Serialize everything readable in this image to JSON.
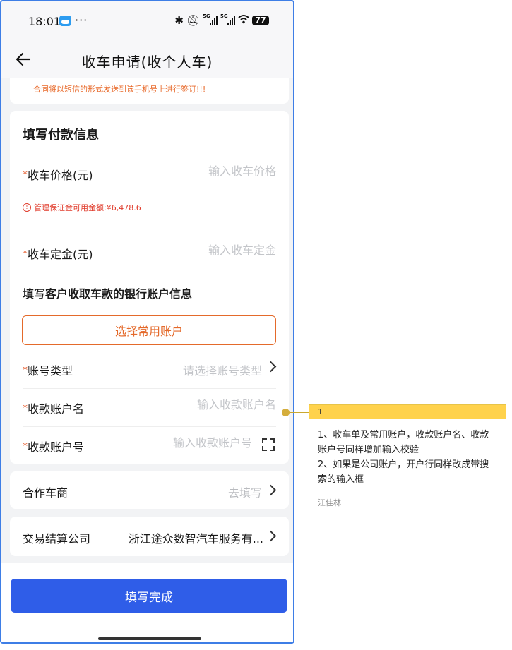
{
  "status_bar": {
    "time": "18:01",
    "dots": "···",
    "icons": [
      "bluetooth-icon",
      "mute-icon",
      "signal-5g-icon",
      "signal-5g-icon",
      "wifi-icon"
    ],
    "signal_label": "5G",
    "battery": "77"
  },
  "nav": {
    "back_icon": "arrow-left-icon",
    "title": "收车申请(收个人车)"
  },
  "notice": {
    "text": "合同将以短信的形式发送到该手机号上进行签订!!!"
  },
  "payment": {
    "title": "填写付款信息",
    "price": {
      "required": "*",
      "label": "收车价格(元)",
      "placeholder": "输入收车价格"
    },
    "warning": {
      "icon": "!",
      "text": "管理保证金可用金额:¥6,478.6"
    },
    "deposit": {
      "required": "*",
      "label": "收车定金(元)",
      "placeholder": "输入收车定金"
    },
    "bank_title": "填写客户收取车款的银行账户信息",
    "select_account_label": "选择常用账户",
    "account_type": {
      "required": "*",
      "label": "账号类型",
      "placeholder": "请选择账号类型"
    },
    "account_name": {
      "required": "*",
      "label": "收款账户名",
      "placeholder": "输入收款账户名"
    },
    "account_number": {
      "required": "*",
      "label": "收款账户号",
      "placeholder": "输入收款账户号"
    }
  },
  "dealer": {
    "label": "合作车商",
    "value": "去填写"
  },
  "settlement": {
    "label": "交易结算公司",
    "value": "浙江途众数智汽车服务有..."
  },
  "submit_label": "填写完成",
  "annotation": {
    "number": "1",
    "lines": [
      "1、收车单及常用账户，收款账户名、收款账户号同样增加输入校验",
      "2、如果是公司账户，开户行同样改成带搜索的输入框"
    ],
    "author": "江佳林",
    "colors": {
      "header": "#ffd24c",
      "border": "#e7c448"
    }
  },
  "colors": {
    "primary": "#2f5de8",
    "accent": "#e46a2b",
    "error": "#e03b2b"
  }
}
